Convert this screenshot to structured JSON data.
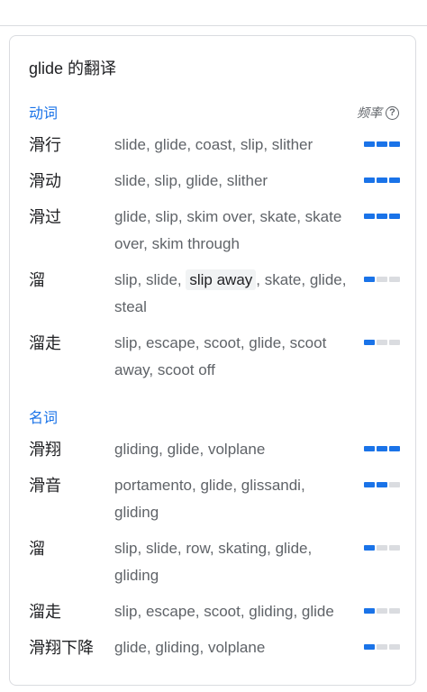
{
  "title": "glide 的翻译",
  "frequency_label": "频率",
  "help_glyph": "?",
  "colors": {
    "accent": "#1a73e8",
    "bar_off": "#dadce0"
  },
  "sections": [
    {
      "label": "动词",
      "entries": [
        {
          "word": "滑行",
          "translations": "slide, glide, coast, slip, slither",
          "frequency": 3
        },
        {
          "word": "滑动",
          "translations": "slide, slip, glide, slither",
          "frequency": 3
        },
        {
          "word": "滑过",
          "translations": "glide, slip, skim over, skate, skate over, skim through",
          "frequency": 3
        },
        {
          "word": "溜",
          "pre": "slip, slide, ",
          "highlight": "slip away",
          "post": ", skate, glide, steal",
          "translations": "slip, slide, slip away, skate, glide, steal",
          "frequency": 1
        },
        {
          "word": "溜走",
          "translations": "slip, escape, scoot, glide, scoot away, scoot off",
          "frequency": 1
        }
      ]
    },
    {
      "label": "名词",
      "entries": [
        {
          "word": "滑翔",
          "translations": "gliding, glide, volplane",
          "frequency": 3
        },
        {
          "word": "滑音",
          "translations": "portamento, glide, glissandi, gliding",
          "frequency": 2
        },
        {
          "word": "溜",
          "translations": "slip, slide, row, skating, glide, gliding",
          "frequency": 1
        },
        {
          "word": "溜走",
          "translations": "slip, escape, scoot, gliding, glide",
          "frequency": 1
        },
        {
          "word": "滑翔下降",
          "translations": "glide, gliding, volplane",
          "frequency": 1
        }
      ]
    }
  ]
}
